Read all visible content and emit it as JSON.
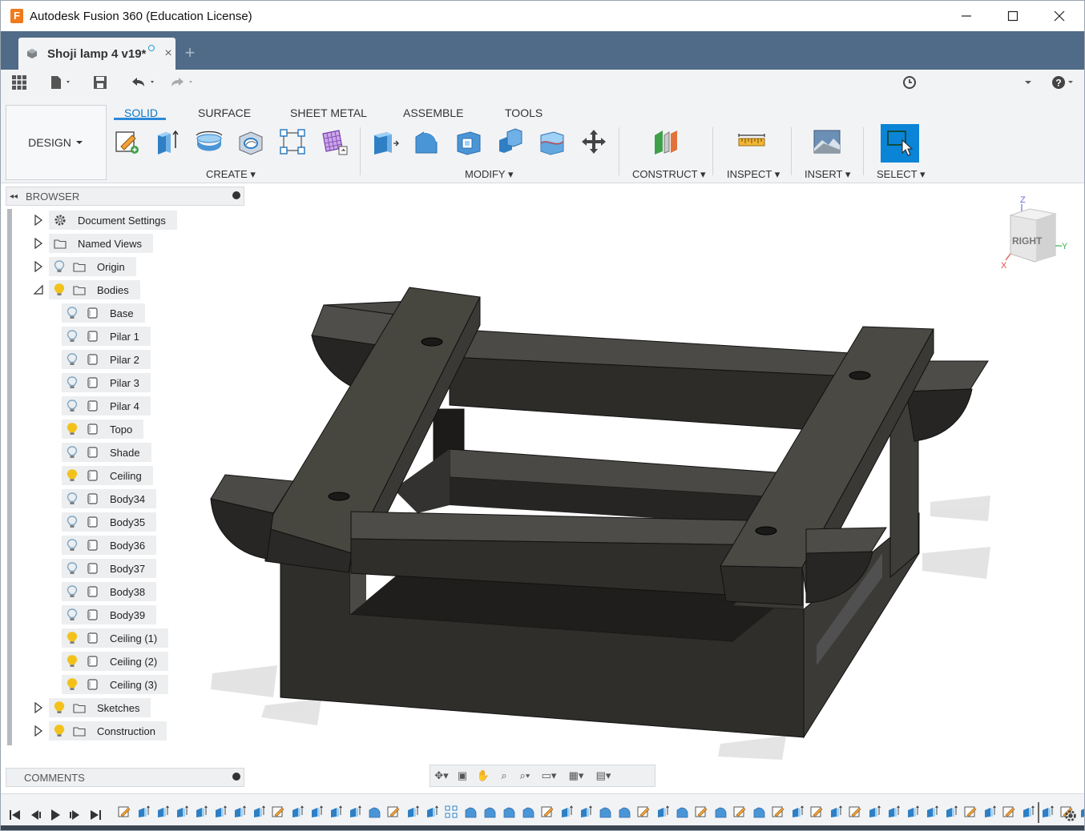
{
  "window": {
    "app_icon_letter": "F",
    "title": "Autodesk Fusion 360 (Education License)",
    "controls": [
      "minimize-icon",
      "maximize-icon",
      "close-icon"
    ]
  },
  "doc_tab": {
    "label": "Shoji lamp 4 v19*",
    "close": "×",
    "new_tab": "+"
  },
  "ribbon": {
    "workspace": "DESIGN",
    "tabs": [
      "SOLID",
      "SURFACE",
      "SHEET METAL",
      "ASSEMBLE",
      "TOOLS"
    ],
    "active_tab": "SOLID",
    "groups": [
      "CREATE",
      "MODIFY",
      "CONSTRUCT",
      "INSPECT",
      "INSERT",
      "SELECT"
    ]
  },
  "browser": {
    "title": "BROWSER",
    "items": [
      {
        "label": "Document Settings",
        "level": 0,
        "expanded": false,
        "icon": "gear-icon"
      },
      {
        "label": "Named Views",
        "level": 0,
        "expanded": false,
        "icon": "folder-icon"
      },
      {
        "label": "Origin",
        "level": 0,
        "expanded": false,
        "icon": "folder-icon",
        "visible": false
      },
      {
        "label": "Bodies",
        "level": 0,
        "expanded": true,
        "icon": "folder-icon",
        "visible": true
      },
      {
        "label": "Base",
        "level": 1,
        "visible": false
      },
      {
        "label": "Pilar 1",
        "level": 1,
        "visible": false
      },
      {
        "label": "Pilar 2",
        "level": 1,
        "visible": false
      },
      {
        "label": "Pilar 3",
        "level": 1,
        "visible": false
      },
      {
        "label": "Pilar 4",
        "level": 1,
        "visible": false
      },
      {
        "label": "Topo",
        "level": 1,
        "visible": true
      },
      {
        "label": "Shade",
        "level": 1,
        "visible": false
      },
      {
        "label": "Ceiling",
        "level": 1,
        "visible": true
      },
      {
        "label": "Body34",
        "level": 1,
        "visible": false
      },
      {
        "label": "Body35",
        "level": 1,
        "visible": false
      },
      {
        "label": "Body36",
        "level": 1,
        "visible": false
      },
      {
        "label": "Body37",
        "level": 1,
        "visible": false
      },
      {
        "label": "Body38",
        "level": 1,
        "visible": false
      },
      {
        "label": "Body39",
        "level": 1,
        "visible": false
      },
      {
        "label": "Ceiling (1)",
        "level": 1,
        "visible": true
      },
      {
        "label": "Ceiling (2)",
        "level": 1,
        "visible": true
      },
      {
        "label": "Ceiling (3)",
        "level": 1,
        "visible": true
      },
      {
        "label": "Sketches",
        "level": 0,
        "expanded": false,
        "icon": "folder-icon",
        "visible": true
      },
      {
        "label": "Construction",
        "level": 0,
        "expanded": false,
        "icon": "folder-icon",
        "visible": true
      }
    ]
  },
  "viewcube": {
    "face": "RIGHT",
    "axes": [
      "Z",
      "Y",
      "X"
    ]
  },
  "comments": {
    "title": "COMMENTS"
  },
  "colors": {
    "tab_bar": "#506b87",
    "accent": "#0f79c5",
    "select_active": "#0a84d6",
    "body_top": "#4a4843",
    "body_side": "#2f2e2b",
    "bulb_on": "#f2c21b",
    "bulb_off": "#7fa7c6"
  },
  "timeline": {
    "features": [
      "sketch",
      "extrude",
      "extrude",
      "extrude",
      "extrude",
      "extrude",
      "extrude",
      "extrude",
      "sketch",
      "extrude",
      "extrude",
      "extrude",
      "extrude",
      "fillet",
      "sketch",
      "extrude",
      "extrude",
      "pattern",
      "fillet",
      "fillet",
      "fillet",
      "fillet",
      "sketch",
      "extrude",
      "extrude",
      "fillet",
      "fillet",
      "sketch",
      "extrude",
      "fillet",
      "sketch",
      "fillet",
      "sketch",
      "fillet",
      "sketch",
      "extrude",
      "sketch",
      "extrude",
      "sketch",
      "extrude",
      "extrude",
      "extrude",
      "extrude",
      "extrude",
      "sketch",
      "extrude",
      "sketch",
      "extrude",
      "extrude",
      "sketch",
      "extrude"
    ]
  }
}
